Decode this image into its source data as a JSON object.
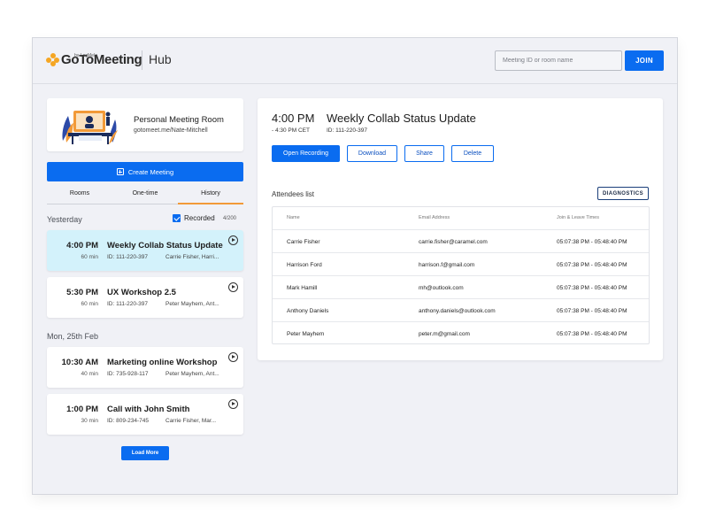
{
  "header": {
    "brand": "GoToMeeting",
    "brand_sub": "by LogMeIn",
    "section": "Hub",
    "search_placeholder": "Meeting ID or room name",
    "join_label": "JOIN"
  },
  "personal_room": {
    "title": "Personal Meeting Room",
    "url": "gotomeet.me/Nate-Mitchell"
  },
  "create_label": "Create Meeting",
  "tabs": [
    {
      "label": "Rooms"
    },
    {
      "label": "One-time"
    },
    {
      "label": "History",
      "active": true
    }
  ],
  "groups": [
    {
      "label": "Yesterday"
    },
    {
      "label": "Mon, 25th Feb"
    }
  ],
  "filter": {
    "label": "Recorded",
    "checked": true,
    "count": "4/200"
  },
  "meetings": [
    {
      "time": "4:00 PM",
      "duration": "60 min",
      "title": "Weekly Collab Status Update",
      "id": "ID: 111-220-397",
      "people": "Carrie Fisher, Harri...",
      "selected": true
    },
    {
      "time": "5:30 PM",
      "duration": "60 min",
      "title": "UX Workshop 2.5",
      "id": "ID: 111-220-397",
      "people": "Peter Mayhem, Ant..."
    },
    {
      "time": "10:30 AM",
      "duration": "40 min",
      "title": "Marketing online Workshop",
      "id": "ID: 735-928-117",
      "people": "Peter Mayhem, Ant..."
    },
    {
      "time": "1:00 PM",
      "duration": "30 min",
      "title": "Call with John Smith",
      "id": "ID: 809-234-745",
      "people": "Carrie Fisher, Mar..."
    }
  ],
  "load_more": "Load More",
  "detail": {
    "time": "4:00 PM",
    "end": "- 4:30 PM CET",
    "title": "Weekly Collab Status Update",
    "id": "ID: 111-220-397",
    "actions": {
      "open_recording": "Open Recording",
      "download": "Download",
      "share": "Share",
      "delete": "Delete"
    },
    "attendees_label": "Attendees list",
    "diagnostics": "DIAGNOSTICS",
    "columns": {
      "name": "Name",
      "email": "Email Address",
      "times": "Join & Leave Times"
    },
    "attendees": [
      {
        "name": "Carrie Fisher",
        "email": "carrie.fisher@caramel.com",
        "times": "05:07:38 PM - 05:48:40 PM"
      },
      {
        "name": "Harrison Ford",
        "email": "harrison.f@gmail.com",
        "times": "05:07:38 PM - 05:48:40 PM"
      },
      {
        "name": "Mark Hamill",
        "email": "mh@outlook.com",
        "times": "05:07:38 PM - 05:48:40 PM"
      },
      {
        "name": "Anthony Daniels",
        "email": "anthony.daniels@outlook.com",
        "times": "05:07:38 PM - 05:48:40 PM"
      },
      {
        "name": "Peter Mayhem",
        "email": "peter.m@gmail.com",
        "times": "05:07:38 PM - 05:48:40 PM"
      }
    ]
  },
  "colors": {
    "accent": "#0a6cf0",
    "tab_indicator": "#f29a38",
    "selected_card": "#d3f2fb",
    "logo": "#f5a623"
  }
}
